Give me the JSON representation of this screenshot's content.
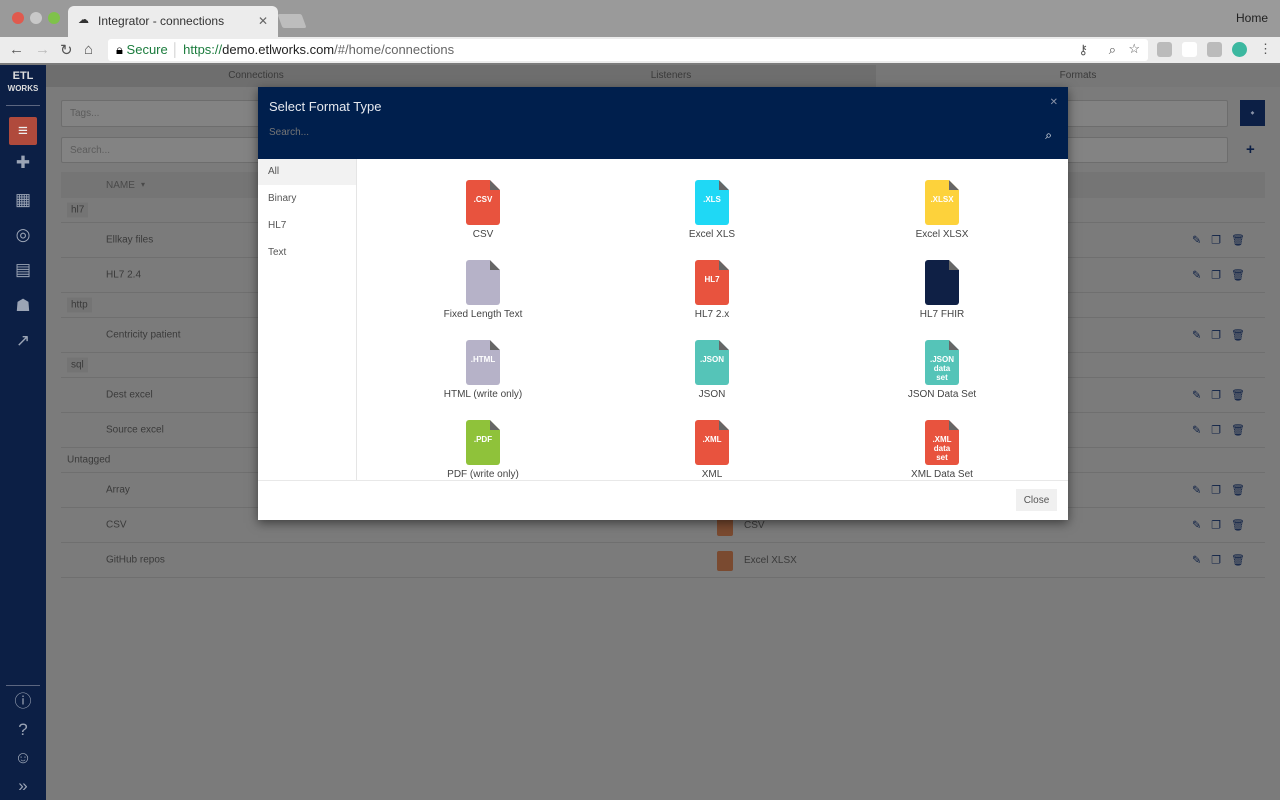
{
  "browser": {
    "tab_title": "Integrator - connections",
    "profile_label": "Home",
    "secure_label": "Secure",
    "url_scheme": "https://",
    "url_host": "demo.etlworks.com",
    "url_path": "/#/home/connections"
  },
  "sidebar": {
    "logo": "ETL WORKS",
    "items": [
      "database-icon",
      "puzzle-icon",
      "calendar-icon",
      "compass-icon",
      "archive-icon",
      "users-icon",
      "chart-icon"
    ],
    "bottom": [
      "info-icon",
      "help-icon",
      "user-icon",
      "expand-icon"
    ],
    "accent": "#e8533e"
  },
  "topnav": {
    "tabs": [
      "Connections",
      "Listeners",
      "Formats"
    ],
    "active": "Formats"
  },
  "filters": {
    "tags_placeholder": "Tags...",
    "search_placeholder": "Search..."
  },
  "grid": {
    "header": "NAME",
    "rows": [
      {
        "type": "group",
        "name": "hl7"
      },
      {
        "type": "item",
        "name": "Ellkay files"
      },
      {
        "type": "item",
        "name": "HL7 2.4"
      },
      {
        "type": "group",
        "name": "http"
      },
      {
        "type": "item",
        "name": "Centricity patient"
      },
      {
        "type": "group",
        "name": "sql"
      },
      {
        "type": "item",
        "name": "Dest excel"
      },
      {
        "type": "item",
        "name": "Source excel"
      },
      {
        "type": "untagged",
        "name": "Untagged"
      },
      {
        "type": "item",
        "name": "Array"
      },
      {
        "type": "item",
        "name": "CSV",
        "format": "CSV"
      },
      {
        "type": "item",
        "name": "GitHub repos",
        "format": "Excel XLSX"
      }
    ]
  },
  "modal": {
    "title": "Select Format Type",
    "search_placeholder": "Search...",
    "close_label": "Close",
    "categories": [
      "All",
      "Binary",
      "HL7",
      "Text"
    ],
    "active_category": "All",
    "formats": [
      {
        "label": "CSV",
        "icon_text": ".CSV",
        "color": "#e8533e"
      },
      {
        "label": "Excel XLS",
        "icon_text": ".XLS",
        "color": "#1fd8f5"
      },
      {
        "label": "Excel XLSX",
        "icon_text": ".XLSX",
        "color": "#fdd23b"
      },
      {
        "label": "Fixed Length Text",
        "icon_text": "",
        "color": "#b6b2c8"
      },
      {
        "label": "HL7 2.x",
        "icon_text": "HL7",
        "color": "#e8533e"
      },
      {
        "label": "HL7 FHIR",
        "icon_text": "",
        "color": "#0f2045"
      },
      {
        "label": "HTML (write only)",
        "icon_text": ".HTML",
        "color": "#b6b2c8"
      },
      {
        "label": "JSON",
        "icon_text": ".JSON",
        "color": "#55c4b8"
      },
      {
        "label": "JSON Data Set",
        "icon_text": ".JSON data set",
        "color": "#55c4b8"
      },
      {
        "label": "PDF (write only)",
        "icon_text": ".PDF",
        "color": "#8fc23a"
      },
      {
        "label": "XML",
        "icon_text": ".XML",
        "color": "#e8533e"
      },
      {
        "label": "XML Data Set",
        "icon_text": ".XML data set",
        "color": "#e8533e"
      }
    ]
  }
}
